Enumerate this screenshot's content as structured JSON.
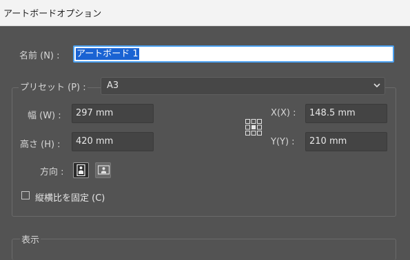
{
  "window": {
    "title": "アートボードオプション"
  },
  "name": {
    "label": "名前 (N) :",
    "value": "アートボード 1"
  },
  "preset": {
    "label": "プリセット (P) :",
    "value": "A3"
  },
  "size": {
    "width_label": "幅 (W) :",
    "width_value": "297 mm",
    "height_label": "高さ (H) :",
    "height_value": "420 mm"
  },
  "position": {
    "x_label": "X(X) :",
    "x_value": "148.5 mm",
    "y_label": "Y(Y) :",
    "y_value": "210 mm"
  },
  "orientation": {
    "label": "方向 :",
    "selected": "portrait"
  },
  "constrain": {
    "label": "縦横比を固定 (C)",
    "checked": false
  },
  "display": {
    "title": "表示"
  },
  "colors": {
    "background": "#535353",
    "selection": "#1a63d3",
    "focus": "#4aa0f0"
  }
}
